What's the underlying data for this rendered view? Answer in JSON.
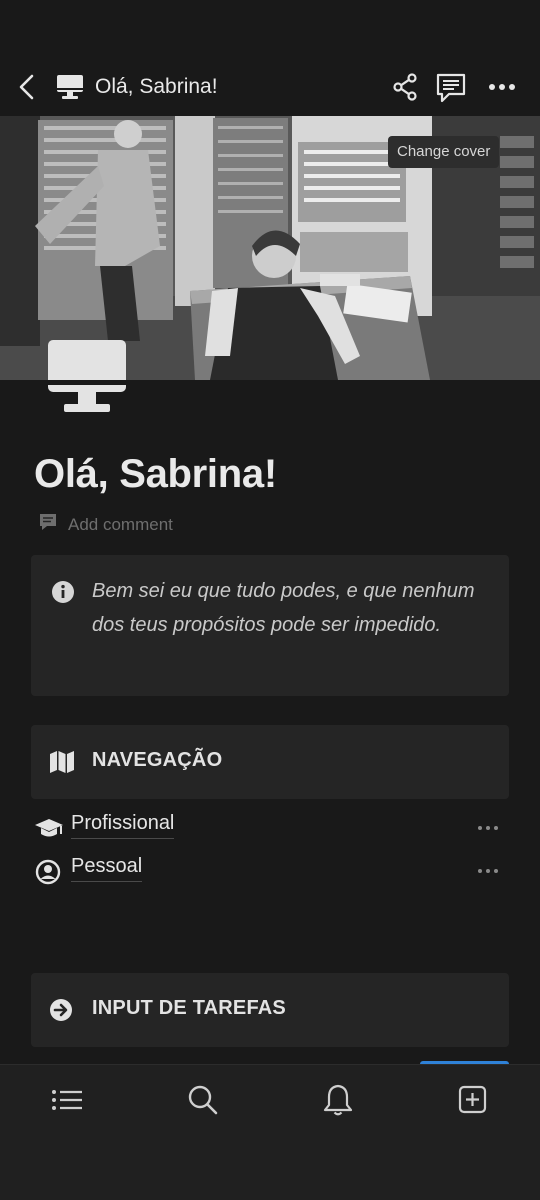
{
  "header": {
    "title": "Olá, Sabrina!",
    "change_cover": "Change cover"
  },
  "page": {
    "title": "Olá, Sabrina!",
    "add_comment": "Add comment",
    "callout_text": "Bem sei eu que tudo podes, e que nenhum dos teus propósitos pode ser impedido."
  },
  "sections": {
    "nav_label": "NAVEGAÇÃO",
    "tasks_label": "INPUT DE TAREFAS"
  },
  "links": [
    {
      "label": "Profissional",
      "icon": "graduation-cap-icon"
    },
    {
      "label": "Pessoal",
      "icon": "user-circle-icon"
    }
  ],
  "bottom_nav": [
    "list-icon",
    "search-icon",
    "bell-icon",
    "plus-square-icon"
  ],
  "colors": {
    "background": "#191919",
    "block": "#252525",
    "accent": "#2f82d8"
  }
}
